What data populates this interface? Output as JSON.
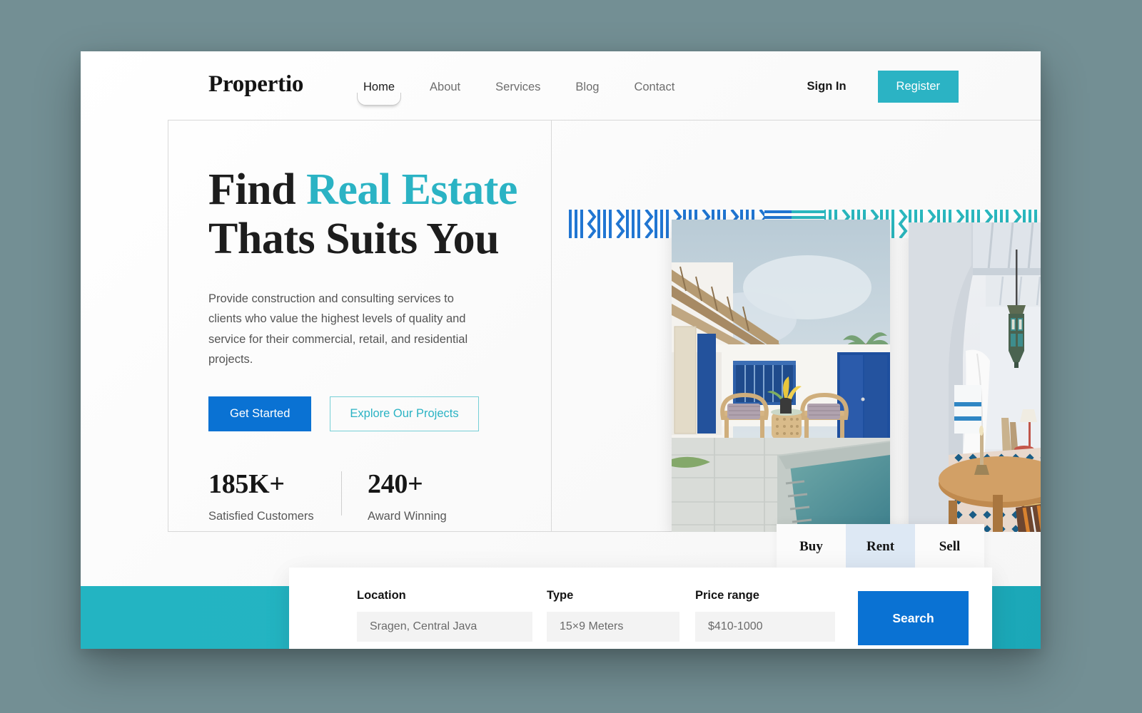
{
  "brand": {
    "name": "Propertio"
  },
  "nav": {
    "items": [
      {
        "label": "Home",
        "active": true
      },
      {
        "label": "About",
        "active": false
      },
      {
        "label": "Services",
        "active": false
      },
      {
        "label": "Blog",
        "active": false
      },
      {
        "label": "Contact",
        "active": false
      }
    ]
  },
  "auth": {
    "signin_label": "Sign In",
    "register_label": "Register"
  },
  "hero": {
    "headline_part1": "Find ",
    "headline_accent": "Real Estate",
    "headline_part2": "Thats Suits You",
    "subcopy": "Provide construction and consulting services to clients who value the highest levels of quality and service for their commercial, retail, and residential projects.",
    "primary_cta": "Get Started",
    "secondary_cta": "Explore Our Projects",
    "stats": [
      {
        "value": "185K+",
        "label": "Satisfied Customers"
      },
      {
        "value": "240+",
        "label": "Award Winning"
      }
    ]
  },
  "tabs": [
    {
      "label": "Buy",
      "active": false
    },
    {
      "label": "Rent",
      "active": true
    },
    {
      "label": "Sell",
      "active": false
    }
  ],
  "search": {
    "location": {
      "label": "Location",
      "value": "Sragen, Central Java",
      "placeholder": "Sragen, Central Java"
    },
    "type": {
      "label": "Type",
      "value": "15×9 Meters",
      "placeholder": "15×9 Meters"
    },
    "price": {
      "label": "Price range",
      "value": "$410-1000",
      "placeholder": "$410-1000"
    },
    "button_label": "Search"
  },
  "colors": {
    "teal_accent": "#2bb3c4",
    "blue_primary": "#0a72d3",
    "pattern_blue": "#2176d2",
    "pattern_teal": "#2bb8bf",
    "tab_active_bg": "#dde8f4",
    "page_backdrop": "#738f94",
    "band_teal": "#23b4c2"
  }
}
